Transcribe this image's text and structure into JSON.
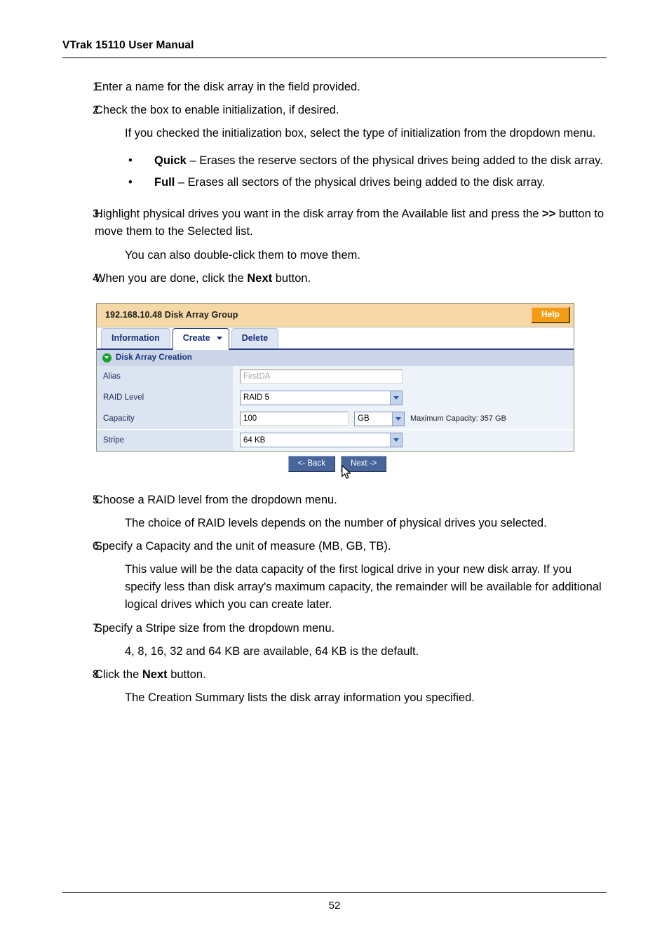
{
  "header": {
    "running_title": "VTrak 15110 User Manual"
  },
  "footer": {
    "page_number": "52"
  },
  "steps": {
    "s1_num": "1.",
    "s1_text": "Enter a name for the disk array in the field provided.",
    "s2_num": "2.",
    "s2_text": "Check the box to enable initialization, if desired.",
    "s2_para": "If you checked the initialization box, select the type of initialization from the dropdown menu.",
    "bullet_dot": "•",
    "b1_term": "Quick",
    "b1_rest": " – Erases the reserve sectors of the physical drives being added to the disk array.",
    "b2_term": "Full",
    "b2_rest": " – Erases all sectors of the physical drives being added to the disk array.",
    "s3_num": "3.",
    "s3_text_a": "Highlight physical drives you want in the disk array from the Available list and press the ",
    "s3_text_b": ">>",
    "s3_text_c": " button to move them to the Selected list.",
    "s3_para": "You can also double-click them to move them.",
    "s4_num": "4.",
    "s4_text_a": "When you are done, click the ",
    "s4_text_b": "Next",
    "s4_text_c": " button.",
    "s5_num": "5.",
    "s5_text": "Choose a RAID level from the dropdown menu.",
    "s5_para": "The choice of RAID levels depends on the number of physical drives you selected.",
    "s6_num": "6.",
    "s6_text": "Specify a Capacity and the unit of measure (MB, GB, TB).",
    "s6_para": "This value will be the data capacity of the first logical drive in your new disk array. If you specify less than disk array's maximum capacity, the remainder will be available for additional logical drives which you can create later.",
    "s7_num": "7.",
    "s7_text": "Specify a Stripe size from the dropdown menu.",
    "s7_para": "4, 8, 16, 32 and 64 KB are available, 64 KB is the default.",
    "s8_num": "8.",
    "s8_text_a": "Click the ",
    "s8_text_b": "Next",
    "s8_text_c": " button.",
    "s8_para": "The Creation Summary lists the disk array information you specified."
  },
  "app": {
    "title": "192.168.10.48 Disk Array Group",
    "help_label": "Help",
    "tabs": [
      {
        "label": "Information",
        "active": false
      },
      {
        "label": "Create",
        "active": true
      },
      {
        "label": "Delete",
        "active": false
      }
    ],
    "section_title": "Disk Array Creation",
    "fields": {
      "alias_label": "Alias",
      "alias_placeholder": "FirstDA",
      "alias_value": "",
      "raid_label": "RAID Level",
      "raid_value": "RAID 5",
      "capacity_label": "Capacity",
      "capacity_value": "100",
      "capacity_unit": "GB",
      "capacity_hint": "Maximum Capacity: 357 GB",
      "stripe_label": "Stripe",
      "stripe_value": "64 KB"
    },
    "buttons": {
      "back_label": "<- Back",
      "next_label": "Next ->"
    },
    "colors": {
      "titlebar": "#f6d7a6",
      "help_button": "#f49c14",
      "tab_text": "#16307c",
      "section_header": "#ccd6e8",
      "row_label": "#dce4f2",
      "nav_button": "#49669c",
      "section_icon": "#17a02c"
    }
  }
}
